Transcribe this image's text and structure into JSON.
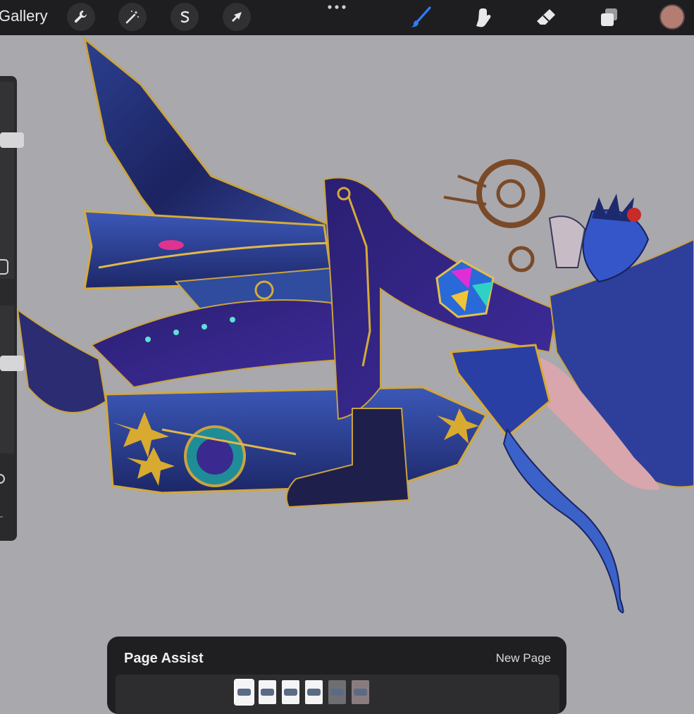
{
  "toolbar": {
    "gallery_label": "Gallery",
    "left_tools": [
      {
        "name": "wrench-icon",
        "label": "Actions"
      },
      {
        "name": "magic-wand-icon",
        "label": "Adjustments"
      },
      {
        "name": "selection-icon",
        "label": "Selection"
      },
      {
        "name": "arrow-cursor-icon",
        "label": "Transform"
      }
    ],
    "right_tools": [
      {
        "name": "brush-icon",
        "label": "Paint",
        "active": true
      },
      {
        "name": "smudge-icon",
        "label": "Smudge"
      },
      {
        "name": "eraser-icon",
        "label": "Erase"
      },
      {
        "name": "layers-icon",
        "label": "Layers"
      }
    ],
    "current_color": "#b47d72",
    "accent_color": "#2f7cf6"
  },
  "sidebar": {
    "brush_size_level": 0.72,
    "opacity_level": 0.62
  },
  "page_assist": {
    "title": "Page Assist",
    "new_page_label": "New Page",
    "pages": [
      {
        "style": "light",
        "selected": true
      },
      {
        "style": "light"
      },
      {
        "style": "light"
      },
      {
        "style": "light"
      },
      {
        "style": "dark"
      },
      {
        "style": "pinkish"
      }
    ]
  }
}
